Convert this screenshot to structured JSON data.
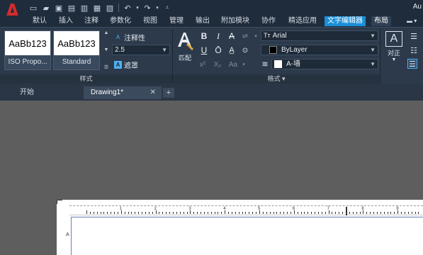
{
  "app": {
    "title_fragment": "Au",
    "logo_letter": "A"
  },
  "tabs": [
    {
      "label": "默认"
    },
    {
      "label": "插入"
    },
    {
      "label": "注释"
    },
    {
      "label": "参数化"
    },
    {
      "label": "视图"
    },
    {
      "label": "管理"
    },
    {
      "label": "输出"
    },
    {
      "label": "附加模块"
    },
    {
      "label": "协作"
    },
    {
      "label": "精选应用"
    },
    {
      "label": "文字编辑器"
    },
    {
      "label": "布局"
    }
  ],
  "ribbon": {
    "style_panel": {
      "label": "样式",
      "styles": [
        {
          "preview": "AaBb123",
          "name": "ISO Propo..."
        },
        {
          "preview": "AaBb123",
          "name": "Standard"
        }
      ],
      "annotative_label": "注释性",
      "text_height": "2.5",
      "mask_label": "遮罩"
    },
    "format_panel": {
      "label": "格式",
      "match_label": "匹配",
      "bold": "B",
      "italic": "I",
      "strike": "A",
      "underline": "U",
      "overline": "Ō",
      "superscript": "x²",
      "subscript": "X₂",
      "case": "Aa",
      "font_icon_text": "Tт",
      "font": "Arial",
      "color": "ByLayer",
      "layer": "A-墙"
    },
    "paragraph_panel": {
      "justify_label": "对正"
    }
  },
  "doc_tabs": [
    {
      "label": "开始"
    },
    {
      "label": "Drawing1*"
    }
  ],
  "ruler_numbers": [
    "1",
    "2",
    "3",
    "4",
    "5",
    "6",
    "7",
    "8",
    "9"
  ],
  "colors": {
    "accent": "#1a8fd8",
    "ribbon": "#2c3a4b",
    "titlebar": "#1f2c3b"
  }
}
